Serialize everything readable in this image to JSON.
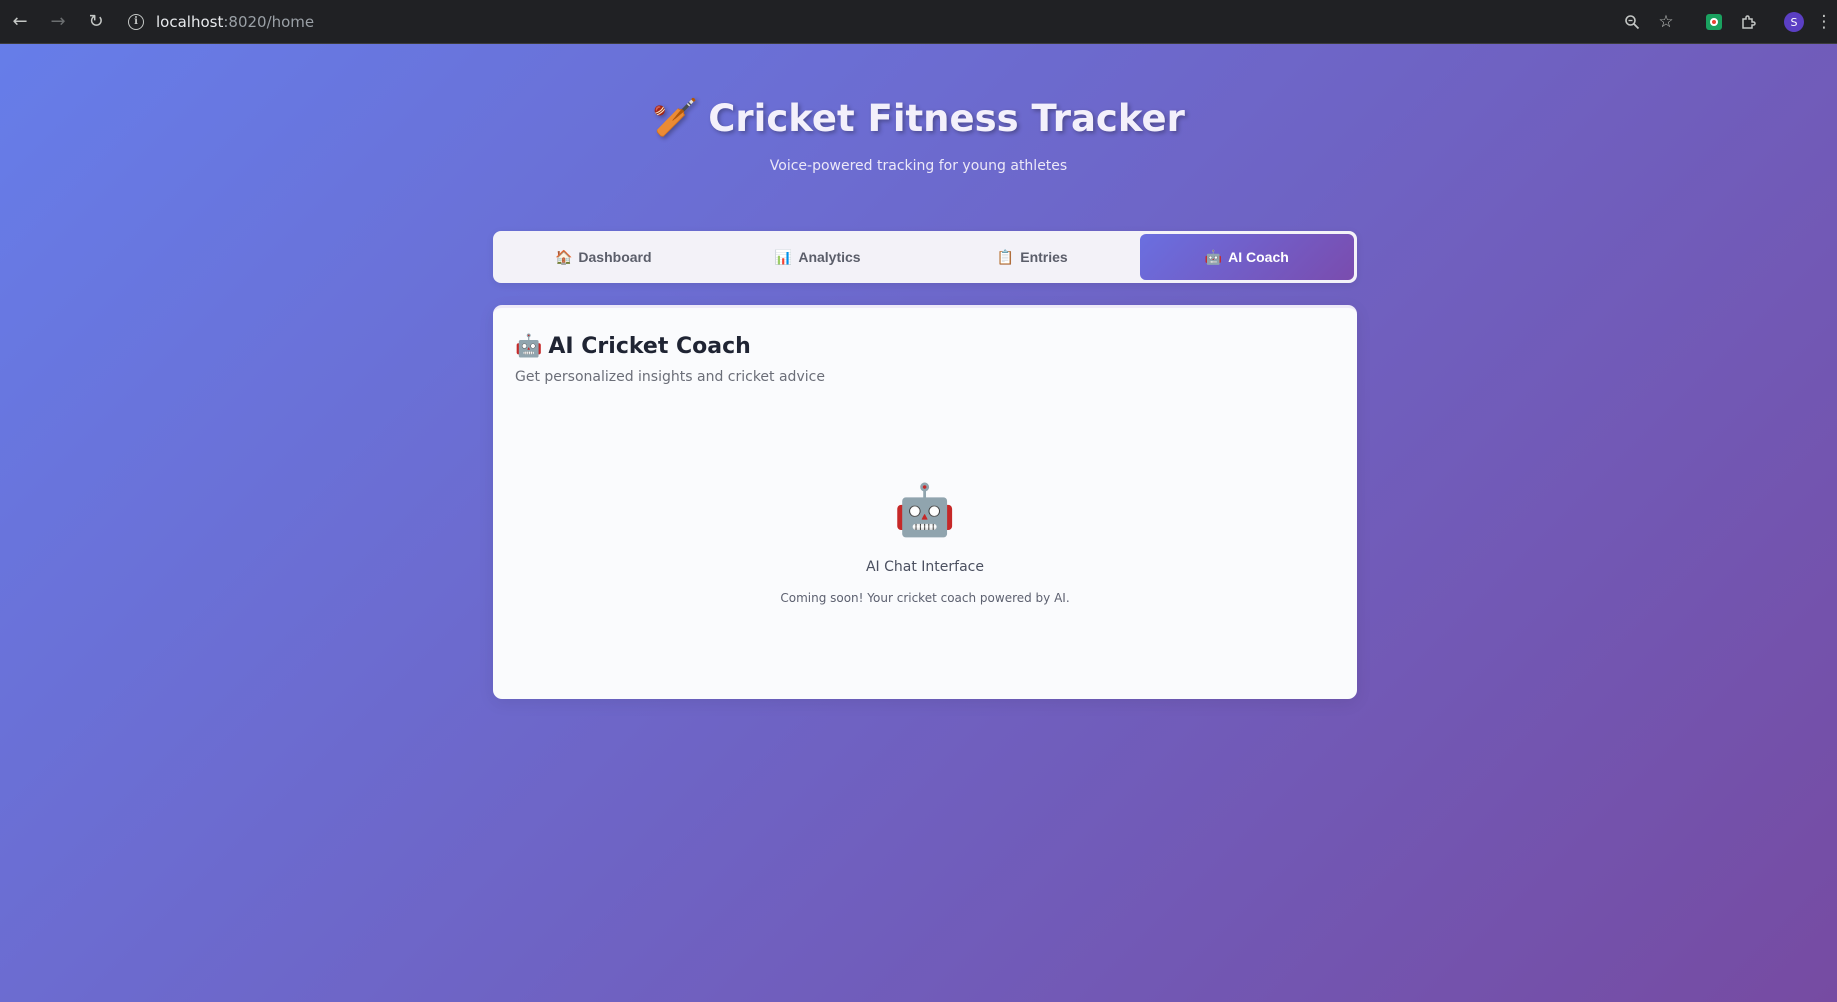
{
  "browser": {
    "url_host": "localhost",
    "url_path": ":8020/home",
    "avatar_letter": "S"
  },
  "header": {
    "icon": "🏏",
    "title": "Cricket Fitness Tracker",
    "subtitle": "Voice-powered tracking for young athletes"
  },
  "tabs": [
    {
      "icon": "🏠",
      "label": "Dashboard",
      "active": false
    },
    {
      "icon": "📊",
      "label": "Analytics",
      "active": false
    },
    {
      "icon": "📋",
      "label": "Entries",
      "active": false
    },
    {
      "icon": "🤖",
      "label": "AI Coach",
      "active": true
    }
  ],
  "coach": {
    "icon": "🤖",
    "title": "AI Cricket Coach",
    "subtitle": "Get personalized insights and cricket advice",
    "placeholder_icon": "🤖",
    "placeholder_title": "AI Chat Interface",
    "placeholder_text": "Coming soon! Your cricket coach powered by AI."
  },
  "colors": {
    "bg_start": "#667eea",
    "bg_end": "#764ba2",
    "active_tab_start": "#6a6fe0",
    "active_tab_end": "#7a4cae"
  }
}
